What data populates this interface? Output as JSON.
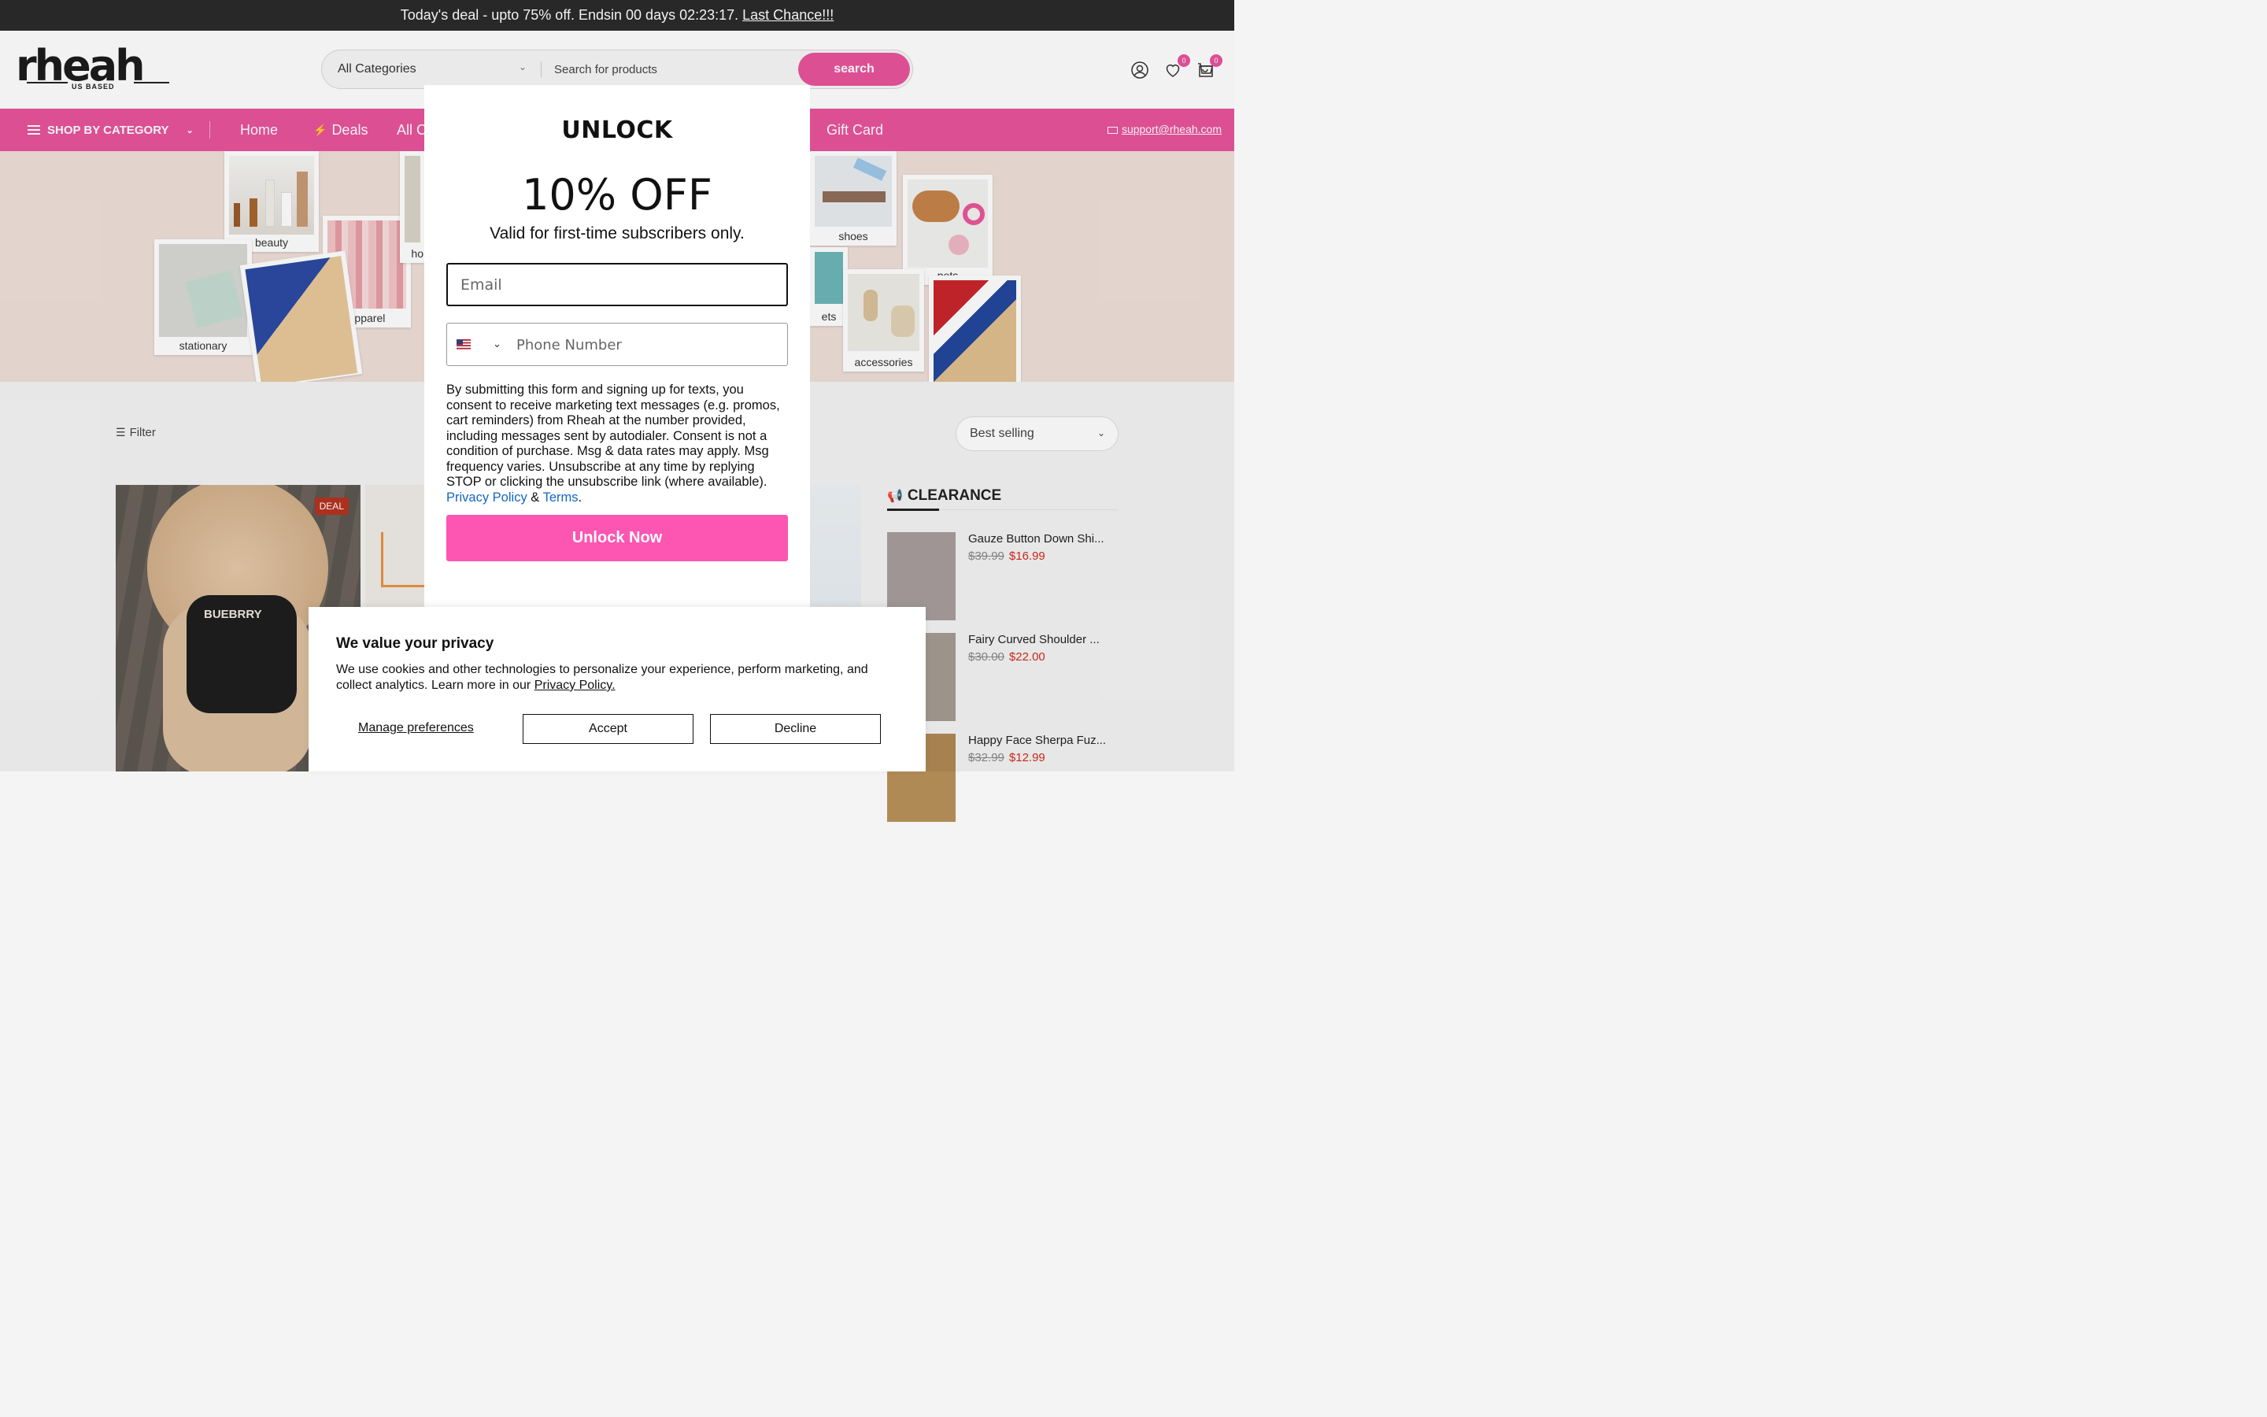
{
  "announcement": {
    "text": "Today's deal - upto 75% off. Endsin 00 days 02:23:17.",
    "link": "Last Chance!!!"
  },
  "header": {
    "logo_text": "rheah",
    "logo_sub": "US BASED",
    "category_select": "All Categories",
    "search_placeholder": "Search for products",
    "search_button": "search",
    "wishlist_count": "0",
    "cart_count": "0"
  },
  "nav": {
    "shop_by_category": "SHOP BY CATEGORY",
    "items": [
      "Home",
      "Deals",
      "All C",
      "Gift Card"
    ],
    "email": "support@rheah.com"
  },
  "hero": {
    "captions": [
      "beauty",
      "stationary",
      "apparel",
      "ho",
      "shoes",
      "pets",
      "ets",
      "accessories"
    ]
  },
  "toolbar": {
    "filter_label": "Filter",
    "sort_value": "Best selling"
  },
  "products": {
    "deal_badge": "DEAL",
    "shirt_text": "BUEBRRY"
  },
  "clearance": {
    "title": "CLEARANCE",
    "items": [
      {
        "name": "Gauze Button Down Shi...",
        "old_price": "$39.99",
        "new_price": "$16.99"
      },
      {
        "name": "Fairy Curved Shoulder ...",
        "old_price": "$30.00",
        "new_price": "$22.00"
      },
      {
        "name": "Happy Face Sherpa Fuz...",
        "old_price": "$32.99",
        "new_price": "$12.99"
      }
    ]
  },
  "popup": {
    "heading": "UNLOCK",
    "offer": "10% OFF",
    "subtext": "Valid for first-time subscribers only.",
    "email_placeholder": "Email",
    "phone_placeholder": "Phone Number",
    "legal": "By submitting this form and signing up for texts, you consent to receive marketing text messages (e.g. promos, cart reminders) from Rheah at the number provided, including messages sent by autodialer. Consent is not a condition of purchase. Msg & data rates may apply. Msg frequency varies. Unsubscribe at any time by replying STOP or clicking the unsubscribe link (where available).",
    "privacy_link": "Privacy Policy",
    "and": "&",
    "terms_link": "Terms",
    "period": ".",
    "button": "Unlock Now"
  },
  "cookie": {
    "title": "We value your privacy",
    "text": "We use cookies and other technologies to personalize your experience, perform marketing, and collect analytics. Learn more in our",
    "link": "Privacy Policy.",
    "manage": "Manage preferences",
    "accept": "Accept",
    "decline": "Decline"
  },
  "colors": {
    "brand_pink": "#e8549b",
    "popup_button": "#fd55b2",
    "announcement_bg": "#2b2b2b",
    "sale_red": "#d42a1c"
  }
}
